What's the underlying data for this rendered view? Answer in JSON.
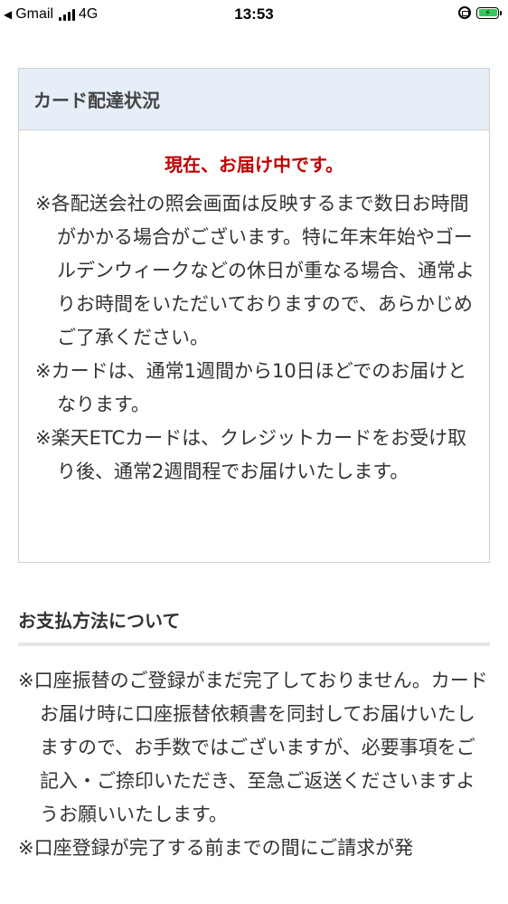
{
  "status_bar": {
    "back_app": "Gmail",
    "network": "4G",
    "time": "13:53"
  },
  "card_delivery": {
    "header": "カード配達状況",
    "status": "現在、お届け中です。",
    "notes": [
      "※各配送会社の照会画面は反映するまで数日お時間がかかる場合がございます。特に年末年始やゴールデンウィークなどの休日が重なる場合、通常よりお時間をいただいておりますので、あらかじめご了承ください。",
      "※カードは、通常1週間から10日ほどでのお届けとなります。",
      "※楽天ETCカードは、クレジットカードをお受け取り後、通常2週間程でお届けいたします。"
    ]
  },
  "payment": {
    "title": "お支払方法について",
    "notes": [
      "※口座振替のご登録がまだ完了しておりません。カードお届け時に口座振替依頼書を同封してお届けいたしますので、お手数ではございますが、必要事項をご記入・ご捺印いただき、至急ご返送くださいますようお願いいたします。",
      "※口座登録が完了する前までの間にご請求が発"
    ]
  },
  "colors": {
    "header_bg": "#e6eef8",
    "status_red": "#c00000",
    "battery_green": "#34c759"
  }
}
